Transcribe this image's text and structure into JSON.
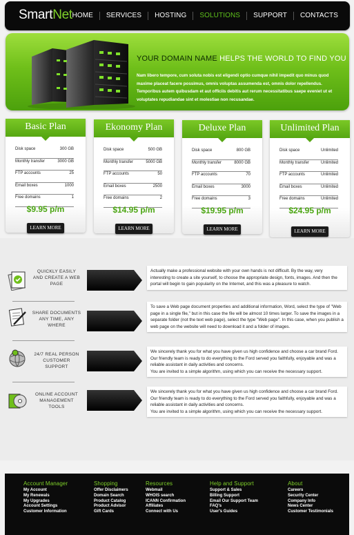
{
  "header": {
    "logo_smart": "Smart",
    "logo_net": "Net",
    "nav": [
      "HOME",
      "SERVICES",
      "HOSTING",
      "SOLUTIONS",
      "SUPPORT",
      "CONTACTS"
    ],
    "active_nav": "SOLUTIONS"
  },
  "hero": {
    "title_dark": "YOUR DOMAIN NAME",
    "title_light": " HELPS THE WORLD TO FIND YOU",
    "text": "Nam libero tempore, cum soluta nobis est eligendi optio cumque nihil impedit quo minus quod maxime placeat facere possimus, omnis voluptas assumenda est, omnis dolor repellendus. Temporibus autem quibusdam et aut officiis debitis aut rerum necessitatibus saepe eveniet ut et voluptates repudiandae sint et molestiae non recusandae."
  },
  "plans": [
    {
      "name": "Basic Plan",
      "rows": [
        [
          "Disk space",
          "300 GB"
        ],
        [
          "Monthly transfer",
          "3000 GB"
        ],
        [
          "FTP accounts",
          "25"
        ],
        [
          "Email boxes",
          "1000"
        ],
        [
          "Free domains",
          "1"
        ]
      ],
      "price": "$9.95 p/m",
      "button": "LEARN MORE"
    },
    {
      "name": "Ekonomy Plan",
      "rows": [
        [
          "Disk space",
          "500 GB"
        ],
        [
          "Monthly transfer",
          "5000 GB"
        ],
        [
          "FTP accounts",
          "50"
        ],
        [
          "Email boxes",
          "2500"
        ],
        [
          "Free domains",
          "2"
        ]
      ],
      "price": "$14.95 p/m",
      "button": "LEARN MORE"
    },
    {
      "name": "Deluxe Plan",
      "rows": [
        [
          "Disk space",
          "800 GB"
        ],
        [
          "Monthly transfer",
          "8000 GB"
        ],
        [
          "FTP accounts",
          "70"
        ],
        [
          "Email boxes",
          "3000"
        ],
        [
          "Free domains",
          "3"
        ]
      ],
      "price": "$19.95 p/m",
      "button": "LEARN MORE"
    },
    {
      "name": "Unlimited Plan",
      "rows": [
        [
          "Disk space",
          "Unlimited"
        ],
        [
          "Monthly transfer",
          "Unlimited"
        ],
        [
          "FTP accounts",
          "Unlimited"
        ],
        [
          "Email boxes",
          "Unlimited"
        ],
        [
          "Free domains",
          "Unlimited"
        ]
      ],
      "price": "$24.95 p/m",
      "button": "LEARN MORE"
    }
  ],
  "features": [
    {
      "icon": "document-check-icon",
      "label": "QUICKLY EASILY AND CREATE A WEB PAGE",
      "text": "Actually make a professional website with your own hands is not difficult. By the way, very interesting to create a site yourself, to choose the appropriate design, fonts, images. And then the portal will begin to gain popularity on the Internet, and this was a pleasure to watch."
    },
    {
      "icon": "pen-document-icon",
      "label": "SHARE DOCUMENTS ANY TIME, ANY WHERE",
      "text": "To save a Web page document properties and additional information, Word, select the type of \"Web page in a single file,\" but in this case the file will be almost 10 times larger. To save the images in a separate folder (not the text web page), select the type \"Web page\". In this case, when you publish a web page on the website will need to download it and a folder of images."
    },
    {
      "icon": "globe-person-icon",
      "label": "24/7 REAL PERSON CUSTOMER SUPPORT",
      "text": "We sincerely thank you for what you have given us high confidence and choose a car brand Ford. Our friendly team is ready to do everything to the Ford served you faithfully, enjoyable and was a reliable assistant in daily activities and concerns.\nYou are invited to a simple algorithm, using which you can receive the necessary support."
    },
    {
      "icon": "disc-box-icon",
      "label": "ONLINE ACCOUNT MANAGEMENT TOOLS",
      "text": "We sincerely thank you for what you have given us high confidence and choose a car brand Ford. Our friendly team is ready to do everything to the Ford served you faithfully, enjoyable and was a reliable assistant in daily activities and concerns.\nYou are invited to a simple algorithm, using which you can receive the necessary support."
    }
  ],
  "footer": [
    {
      "title": "Account Manager",
      "links": [
        "My Account",
        "My Renewals",
        "My Upgrades",
        "Account Settings",
        "Customer Information"
      ]
    },
    {
      "title": "Shopping",
      "links": [
        "Offer Disclaimers",
        "Domain Search",
        "Product Catalog",
        "Product Advisor",
        "Gift Cards"
      ]
    },
    {
      "title": "Resources",
      "links": [
        "Webmail",
        "WHOIS search",
        "ICANN Confirmation",
        "Affiliates",
        "Connect with Us"
      ]
    },
    {
      "title": "Help and Support",
      "links": [
        "Support & Sales",
        "Billing Support",
        "Email Our Support Team",
        "FAQ's",
        "User's Guides"
      ]
    },
    {
      "title": "About",
      "links": [
        "Careers",
        "Security Center",
        "Company Info",
        "News Center",
        "Customer Testimonials"
      ]
    }
  ],
  "colors": {
    "accent": "#6fbf1a",
    "header_bg": "#0a0a0a",
    "price": "#4aa511"
  }
}
